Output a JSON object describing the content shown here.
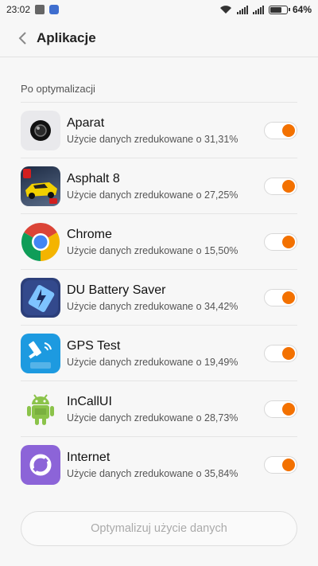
{
  "status_bar": {
    "time": "23:02",
    "battery": "64%",
    "battery_level": 0.64
  },
  "header": {
    "title": "Aplikacje"
  },
  "section": {
    "label": "Po optymalizacji"
  },
  "apps": [
    {
      "name": "Aparat",
      "detail": "Użycie danych zredukowane o 31,31%",
      "icon": "camera-icon",
      "enabled": true
    },
    {
      "name": "Asphalt 8",
      "detail": "Użycie danych zredukowane o 27,25%",
      "icon": "asphalt-icon",
      "enabled": true
    },
    {
      "name": "Chrome",
      "detail": "Użycie danych zredukowane o 15,50%",
      "icon": "chrome-icon",
      "enabled": true
    },
    {
      "name": "DU Battery Saver",
      "detail": "Użycie danych zredukowane o 34,42%",
      "icon": "battery-saver-icon",
      "enabled": true
    },
    {
      "name": "GPS Test",
      "detail": "Użycie danych zredukowane o 19,49%",
      "icon": "gps-icon",
      "enabled": true
    },
    {
      "name": "InCallUI",
      "detail": "Użycie danych zredukowane o 28,73%",
      "icon": "android-icon",
      "enabled": true
    },
    {
      "name": "Internet",
      "detail": "Użycie danych zredukowane o 35,84%",
      "icon": "internet-icon",
      "enabled": true
    }
  ],
  "footer": {
    "button_label": "Optymalizuj użycie danych"
  },
  "colors": {
    "accent": "#f37100"
  }
}
